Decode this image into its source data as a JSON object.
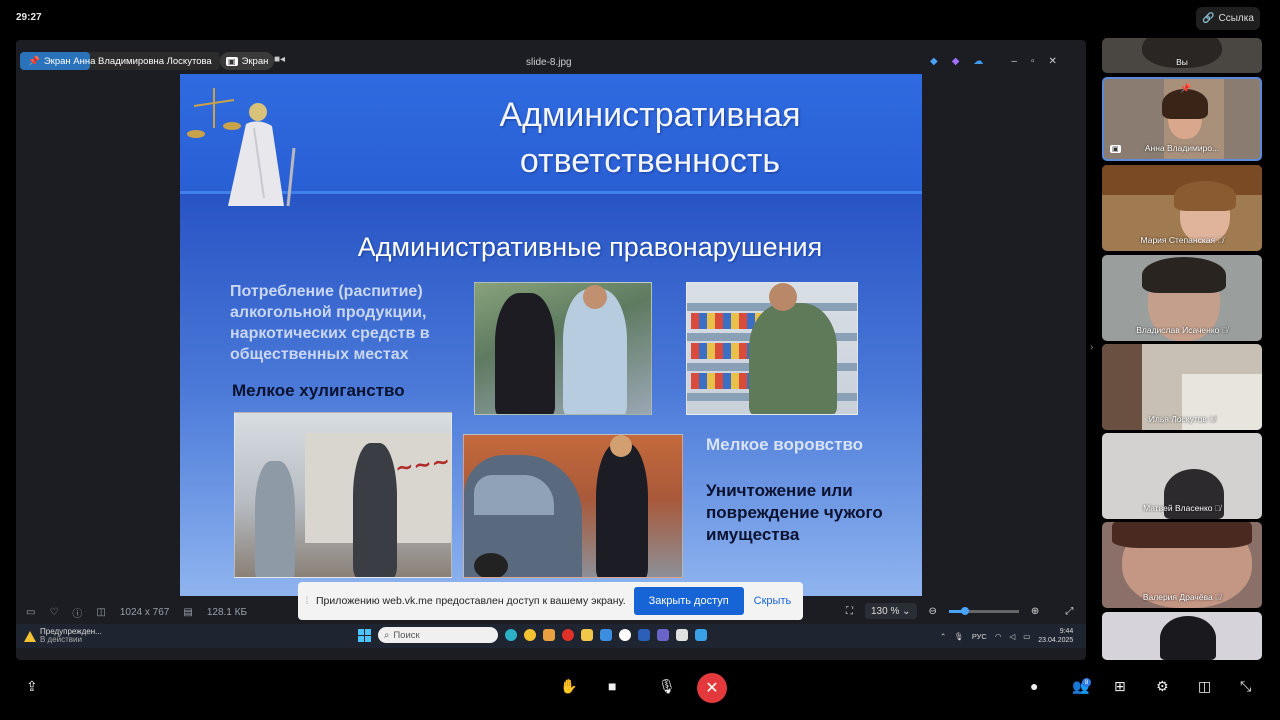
{
  "top": {
    "timer": "29:27",
    "link_label": "Ссылка"
  },
  "viewer": {
    "sharer_label": "Экран Анна Владимировна Лоскутова",
    "screen_pill": "Экран",
    "file_name": "slide-8.jpg",
    "dimensions": "1024 x 767",
    "file_size": "128.1 КБ",
    "zoom": "130 %"
  },
  "slide": {
    "title_line1": "Административная",
    "title_line2": "ответственность",
    "subtitle": "Административные правонарушения",
    "alcohol": "Потребление (распитие) алкогольной продукции, наркотических средств в общественных местах",
    "hooliganism": "Мелкое хулиганство",
    "theft": "Мелкое воровство",
    "damage": "Уничтожение или повреждение чужого имущества"
  },
  "notice": {
    "text": "Приложению web.vk.me предоставлен доступ к вашему экрану.",
    "close_btn": "Закрыть доступ",
    "hide_btn": "Скрыть"
  },
  "taskbar": {
    "warn_line1": "Предупрежден...",
    "warn_line2": "В действии",
    "search_placeholder": "Поиск",
    "lang": "РУС",
    "time": "9:44",
    "date": "23.04.2025"
  },
  "participants": [
    {
      "name": "Вы"
    },
    {
      "name": "Анна Владимиро..."
    },
    {
      "name": "Мария Степанская"
    },
    {
      "name": "Владислав Исаченко"
    },
    {
      "name": "Илья Лоскутов"
    },
    {
      "name": "Матвей Власенко"
    },
    {
      "name": "Валерия Драчёва"
    },
    {
      "name": ""
    }
  ],
  "controls": {
    "participants_badge": "8"
  },
  "colors": {
    "accent": "#1764d6",
    "end_call": "#e3393d",
    "slide_blue": "#2a5fd0"
  }
}
